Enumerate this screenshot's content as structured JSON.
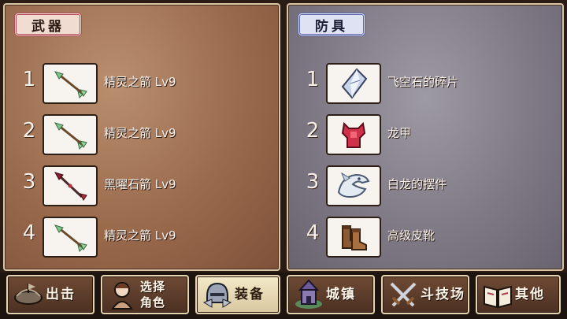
{
  "weapons": {
    "title": "武器",
    "items": [
      {
        "num": "1",
        "name": "精灵之箭 Lv9",
        "icon": "elf-arrow-icon"
      },
      {
        "num": "2",
        "name": "精灵之箭 Lv9",
        "icon": "elf-arrow-icon"
      },
      {
        "num": "3",
        "name": "黑曜石箭 Lv9",
        "icon": "obsidian-arrow-icon"
      },
      {
        "num": "4",
        "name": "精灵之箭 Lv9",
        "icon": "elf-arrow-icon"
      }
    ]
  },
  "armor": {
    "title": "防具",
    "items": [
      {
        "num": "1",
        "name": "飞空石的碎片",
        "icon": "crystal-shard-icon"
      },
      {
        "num": "2",
        "name": "龙甲",
        "icon": "dragon-armor-icon"
      },
      {
        "num": "3",
        "name": "白龙的摆件",
        "icon": "white-dragon-ornament-icon"
      },
      {
        "num": "4",
        "name": "高级皮靴",
        "icon": "leather-boots-icon"
      }
    ]
  },
  "nav": {
    "sortie": "出击",
    "select_character": "选择\n角色",
    "equipment": "装备",
    "town": "城镇",
    "arena": "斗技场",
    "other": "其他",
    "active": "equipment"
  },
  "colors": {
    "weapons_title_border": "#b24a5a",
    "armor_title_border": "#5b66a8",
    "elf_arrow_head": "#7fc48a",
    "obsidian_arrow_head": "#8a1e2e"
  }
}
